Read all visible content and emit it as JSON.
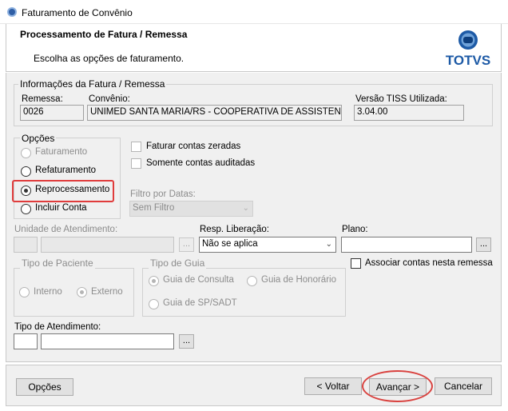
{
  "window": {
    "title": "Faturamento de Convênio"
  },
  "header": {
    "title": "Processamento de Fatura / Remessa",
    "subtitle": "Escolha as opções de faturamento.",
    "logo_text": "TOTVS"
  },
  "info": {
    "legend": "Informações da Fatura / Remessa",
    "remessa_label": "Remessa:",
    "remessa_value": "0026",
    "convenio_label": "Convênio:",
    "convenio_value": "UNIMED SANTA MARIA/RS - COOPERATIVA DE ASSISTENCIA",
    "tiss_label": "Versão TISS Utilizada:",
    "tiss_value": "3.04.00"
  },
  "opcoes": {
    "legend": "Opções",
    "items": [
      {
        "label": "Faturamento",
        "selected": false,
        "enabled": false
      },
      {
        "label": "Refaturamento",
        "selected": false,
        "enabled": true
      },
      {
        "label": "Reprocessamento",
        "selected": true,
        "enabled": true
      },
      {
        "label": "Incluir Conta",
        "selected": false,
        "enabled": true
      }
    ]
  },
  "checks": {
    "zeradas": "Faturar contas zeradas",
    "auditadas": "Somente contas auditadas"
  },
  "filtro": {
    "label": "Filtro por Datas:",
    "value": "Sem Filtro"
  },
  "unidade": {
    "label": "Unidade de Atendimento:",
    "browse": "..."
  },
  "resp": {
    "label": "Resp. Liberação:",
    "value": "Não se aplica"
  },
  "plano": {
    "label": "Plano:",
    "browse": "..."
  },
  "associar": "Associar contas nesta remessa",
  "tipo_paciente": {
    "legend": "Tipo de Paciente",
    "interno": "Interno",
    "externo": "Externo"
  },
  "tipo_guia": {
    "legend": "Tipo de Guia",
    "consulta": "Guia de Consulta",
    "honorario": "Guia de Honorário",
    "spsadt": "Guia de SP/SADT"
  },
  "tipo_atendimento": {
    "label": "Tipo de Atendimento:",
    "browse": "..."
  },
  "footer": {
    "opcoes": "Opções",
    "voltar": "< Voltar",
    "avancar": "Avançar >",
    "cancelar": "Cancelar"
  },
  "colors": {
    "highlight": "#e03c3c",
    "panel": "#f0f0f0",
    "logo_blue": "#1d5aa6"
  }
}
